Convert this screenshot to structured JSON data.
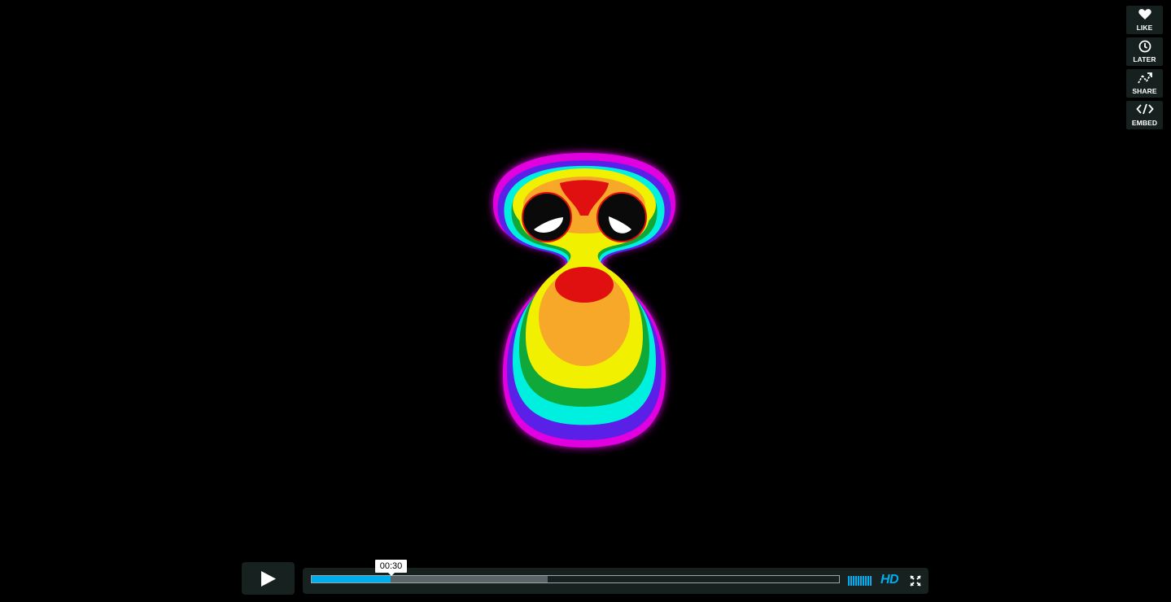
{
  "side_actions": [
    {
      "label": "LIKE",
      "icon": "heart-icon"
    },
    {
      "label": "LATER",
      "icon": "clock-icon"
    },
    {
      "label": "SHARE",
      "icon": "share-icon"
    },
    {
      "label": "EMBED",
      "icon": "embed-icon"
    }
  ],
  "controls": {
    "play_icon": "play-icon",
    "hover_time": "00:30",
    "played_fraction": 0.15,
    "buffered_fraction": 0.447,
    "hd_label": "HD",
    "volume_bars": 10,
    "fullscreen_icon": "fullscreen-icon"
  },
  "colors": {
    "accent": "#00adef",
    "control_bg": "#172322",
    "background": "#000000"
  }
}
